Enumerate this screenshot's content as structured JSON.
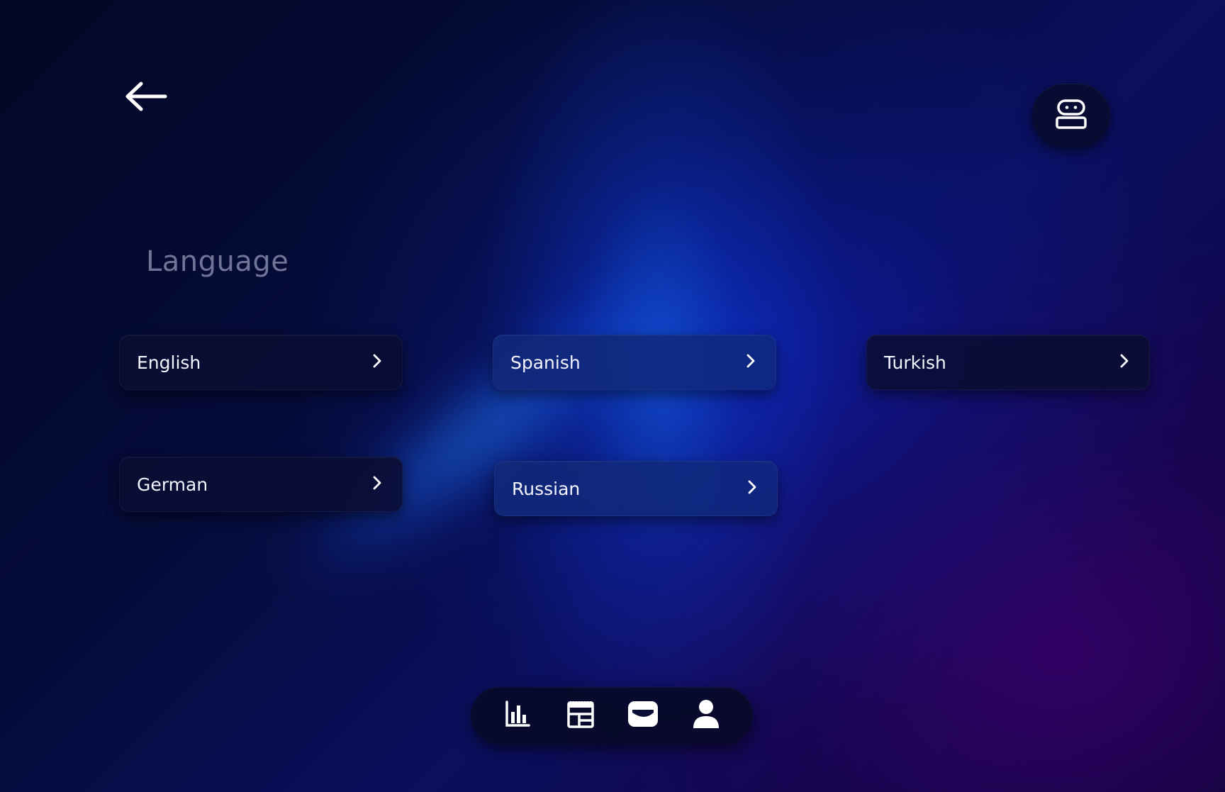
{
  "header": {
    "back_icon": "arrow-left-icon",
    "assistant_icon": "robot-icon"
  },
  "section": {
    "title": "Language"
  },
  "languages": [
    {
      "label": "English",
      "icon": "chevron-right-icon"
    },
    {
      "label": "Spanish",
      "icon": "chevron-right-icon"
    },
    {
      "label": "Turkish",
      "icon": "chevron-right-icon"
    },
    {
      "label": "German",
      "icon": "chevron-right-icon"
    },
    {
      "label": "Russian",
      "icon": "chevron-right-icon"
    }
  ],
  "bottom_nav": {
    "items": [
      {
        "icon": "bar-chart-icon"
      },
      {
        "icon": "calendar-layout-icon"
      },
      {
        "icon": "wallet-icon"
      },
      {
        "icon": "user-icon"
      }
    ]
  },
  "colors": {
    "background_dark": "#030826",
    "accent_blue": "#1e6bff",
    "accent_purple": "#3a0a7a",
    "title_text": "#6f7596",
    "button_text": "#f2f4ff"
  }
}
